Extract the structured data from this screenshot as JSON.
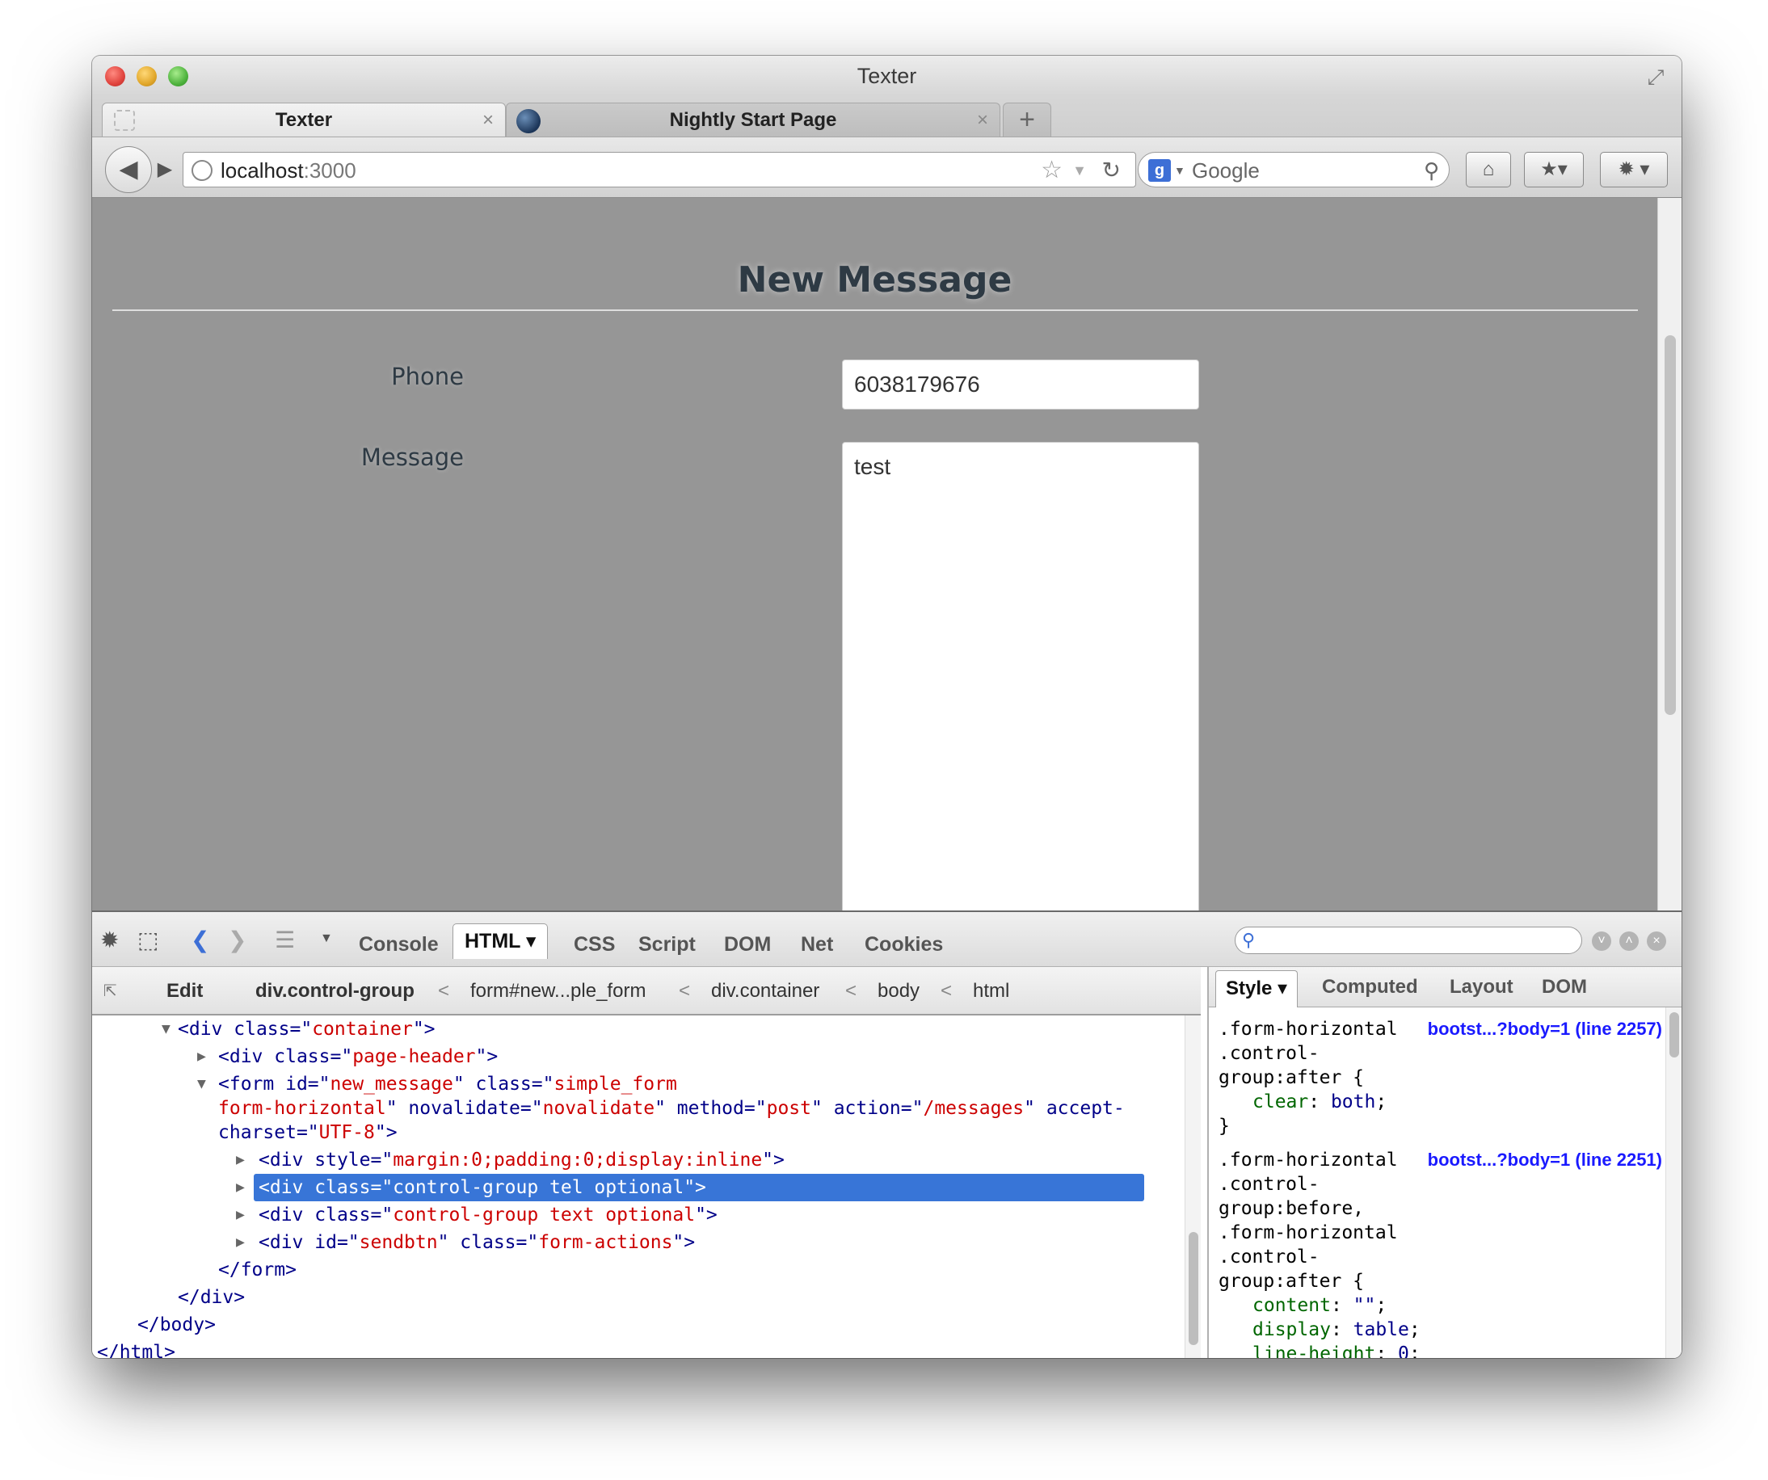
{
  "window": {
    "title": "Texter"
  },
  "tabs": [
    {
      "label": "Texter",
      "close": "×"
    },
    {
      "label": "Nightly Start Page",
      "close": "×"
    }
  ],
  "newtab_label": "+",
  "navbar": {
    "url_host": "localhost",
    "url_port": ":3000",
    "search_placeholder": "Google",
    "search_engine_letter": "g"
  },
  "page": {
    "title": "New Message",
    "phone_label": "Phone",
    "phone_value": "6038179676",
    "message_label": "Message",
    "message_value": "test"
  },
  "firebug": {
    "tabs": [
      "Console",
      "HTML",
      "CSS",
      "Script",
      "DOM",
      "Net",
      "Cookies"
    ],
    "active_tab_label": "HTML ▾",
    "edit_label": "Edit",
    "breadcrumbs": [
      "div.control-group",
      "form#new...ple_form",
      "div.container",
      "body",
      "html"
    ],
    "side_tabs": [
      "Style ▾",
      "Computed",
      "Layout",
      "DOM"
    ],
    "css_source_1": "bootst...?body=1 (line 2257)",
    "css_source_2": "bootst...?body=1 (line 2251)"
  },
  "colors": {
    "content_bg": "#969696",
    "selection": "#3875d7",
    "attr_value": "#cc0000",
    "tag": "#000088"
  }
}
